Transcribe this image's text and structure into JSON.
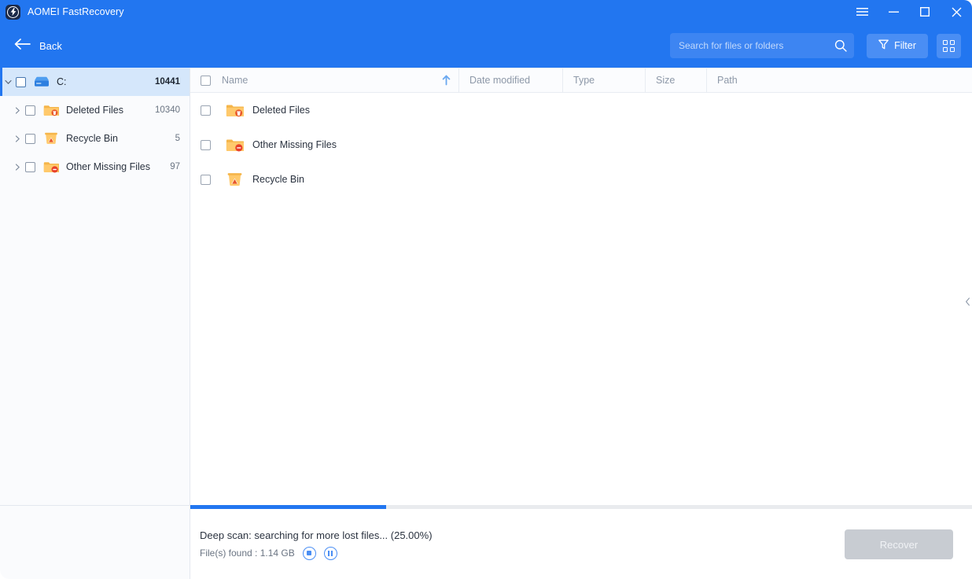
{
  "window": {
    "app_title": "AOMEI FastRecovery",
    "logo_icon": "lightning-bolt-icon",
    "controls": [
      {
        "name": "menu-button",
        "icon": "hamburger-icon"
      },
      {
        "name": "minimize-button",
        "icon": "minimize-icon"
      },
      {
        "name": "maximize-button",
        "icon": "maximize-icon"
      },
      {
        "name": "close-button",
        "icon": "close-icon"
      }
    ],
    "accent_color": "#2276f0",
    "titlebar_color": "#2276f0"
  },
  "toolbar": {
    "back_label": "Back",
    "back_icon": "arrow-left-icon",
    "search": {
      "placeholder": "Search for files or folders",
      "value": "",
      "icon": "search-icon"
    },
    "filter_label": "Filter",
    "filter_icon": "funnel-icon",
    "view_toggle_icon": "grid-view-icon"
  },
  "sidebar": {
    "items": [
      {
        "label": "C:",
        "count": "10441",
        "icon": "drive-icon",
        "depth": 0,
        "selected": true,
        "expanded": true
      },
      {
        "label": "Deleted Files",
        "count": "10340",
        "icon": "folder-deleted-icon",
        "depth": 1,
        "selected": false,
        "expanded": false
      },
      {
        "label": "Recycle Bin",
        "count": "5",
        "icon": "recycle-bin-icon",
        "depth": 1,
        "selected": false,
        "expanded": false
      },
      {
        "label": "Other Missing Files",
        "count": "97",
        "icon": "folder-missing-icon",
        "depth": 1,
        "selected": false,
        "expanded": false
      }
    ]
  },
  "file_list": {
    "columns": [
      {
        "key": "name",
        "label": "Name",
        "sorted": "ascending",
        "sort_icon": "arrow-up-icon"
      },
      {
        "key": "date",
        "label": "Date modified"
      },
      {
        "key": "type",
        "label": "Type"
      },
      {
        "key": "size",
        "label": "Size"
      },
      {
        "key": "path",
        "label": "Path"
      }
    ],
    "rows": [
      {
        "name": "Deleted Files",
        "icon": "folder-deleted-icon",
        "date": "",
        "type": "",
        "size": "",
        "path": "",
        "checked": false
      },
      {
        "name": "Other Missing Files",
        "icon": "folder-missing-icon",
        "date": "",
        "type": "",
        "size": "",
        "path": "",
        "checked": false
      },
      {
        "name": "Recycle Bin",
        "icon": "recycle-bin-icon",
        "date": "",
        "type": "",
        "size": "",
        "path": "",
        "checked": false
      }
    ],
    "collapse_handle_icon": "chevron-left-icon"
  },
  "status": {
    "progress_percent": 25,
    "progress_label": "Deep scan: searching for more lost files... (25.00%)",
    "files_found_label": "File(s) found : 1.14 GB",
    "stop_icon": "stop-circle-icon",
    "pause_icon": "pause-circle-icon",
    "recover_label": "Recover",
    "recover_enabled": false
  }
}
